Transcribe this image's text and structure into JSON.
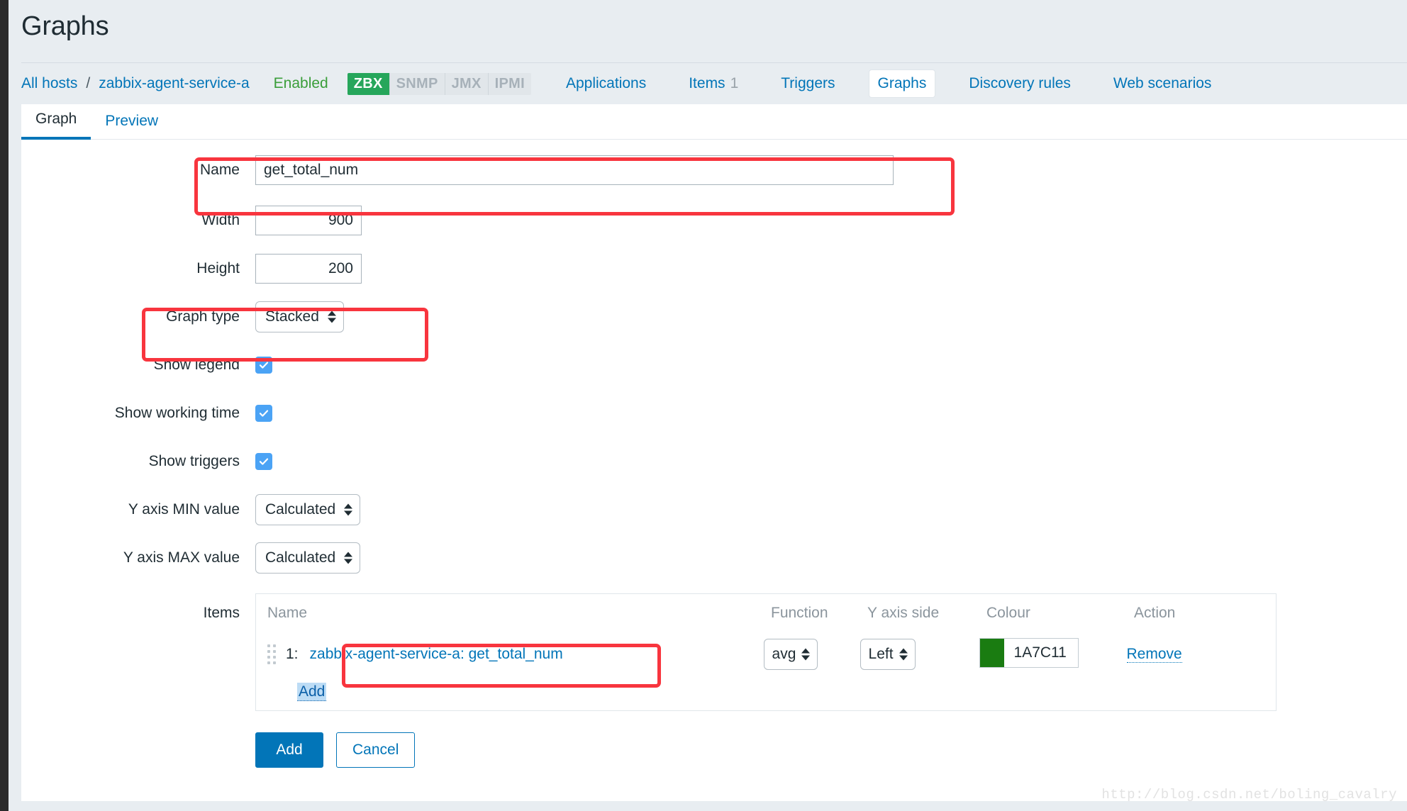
{
  "page": {
    "title": "Graphs"
  },
  "hostnav": {
    "all_hosts": "All hosts",
    "separator": "/",
    "host_name": "zabbix-agent-service-a",
    "status": "Enabled",
    "availability": [
      {
        "label": "ZBX",
        "state": "on"
      },
      {
        "label": "SNMP",
        "state": "off"
      },
      {
        "label": "JMX",
        "state": "off"
      },
      {
        "label": "IPMI",
        "state": "off"
      }
    ],
    "tabs": [
      {
        "label": "Applications",
        "count": "",
        "active": false
      },
      {
        "label": "Items",
        "count": "1",
        "active": false
      },
      {
        "label": "Triggers",
        "count": "",
        "active": false
      },
      {
        "label": "Graphs",
        "count": "",
        "active": true
      },
      {
        "label": "Discovery rules",
        "count": "",
        "active": false
      },
      {
        "label": "Web scenarios",
        "count": "",
        "active": false
      }
    ]
  },
  "form_tabs": [
    {
      "label": "Graph",
      "active": true
    },
    {
      "label": "Preview",
      "active": false
    }
  ],
  "form": {
    "name_label": "Name",
    "name_value": "get_total_num",
    "name_placeholder": "",
    "width_label": "Width",
    "width_value": "900",
    "height_label": "Height",
    "height_value": "200",
    "graph_type_label": "Graph type",
    "graph_type_value": "Stacked",
    "show_legend_label": "Show legend",
    "show_legend_checked": true,
    "show_working_time_label": "Show working time",
    "show_working_time_checked": true,
    "show_triggers_label": "Show triggers",
    "show_triggers_checked": true,
    "y_min_label": "Y axis MIN value",
    "y_min_value": "Calculated",
    "y_max_label": "Y axis MAX value",
    "y_max_value": "Calculated",
    "items_label": "Items"
  },
  "items_table": {
    "headers": {
      "name": "Name",
      "function": "Function",
      "yaxis": "Y axis side",
      "colour": "Colour",
      "action": "Action"
    },
    "rows": [
      {
        "index": "1:",
        "name": "zabbix-agent-service-a: get_total_num",
        "function": "avg",
        "yaxis_side": "Left",
        "colour_hex": "1A7C11",
        "colour_swatch": "#1A7C11",
        "action": "Remove"
      }
    ],
    "add_link": "Add"
  },
  "footer": {
    "submit_label": "Add",
    "cancel_label": "Cancel"
  },
  "watermark": "http://blog.csdn.net/boling_cavalry",
  "colors": {
    "accent": "#0275b8",
    "enabled_green": "#3a9e3a",
    "zbx_green": "#26a65b",
    "annotation_red": "#f8353e",
    "item_colour": "#1A7C11"
  }
}
